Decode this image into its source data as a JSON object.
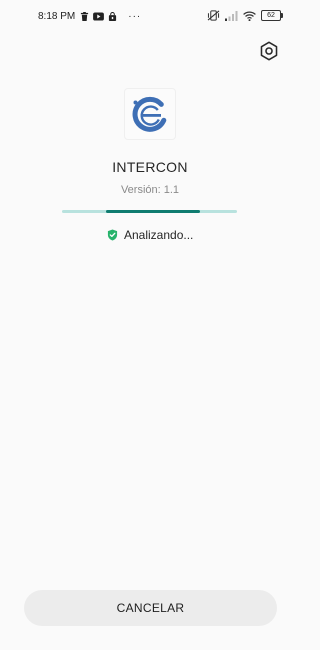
{
  "status_bar": {
    "time": "8:18 PM",
    "overflow": "···",
    "battery": "62",
    "icons": [
      "delete-icon",
      "youtube-icon",
      "bag-icon",
      "vibrate-off-icon",
      "signal-icon",
      "wifi-icon",
      "battery-icon"
    ]
  },
  "toolbar": {
    "settings_icon": "gear-icon"
  },
  "app": {
    "name": "INTERCON",
    "version_label": "Versión: 1.1",
    "icon": "app-logo-icon"
  },
  "scan": {
    "status_text": "Analizando...",
    "status_icon": "shield-check-icon",
    "progress_start": 0.25,
    "progress_end": 0.79
  },
  "actions": {
    "cancel_label": "CANCELAR"
  },
  "colors": {
    "accent": "#0f7c70",
    "track": "#b8e2de",
    "shield": "#27b36b",
    "logo_blue": "#3e6fb5",
    "background": "#fafafa",
    "button_bg": "#ececec"
  }
}
